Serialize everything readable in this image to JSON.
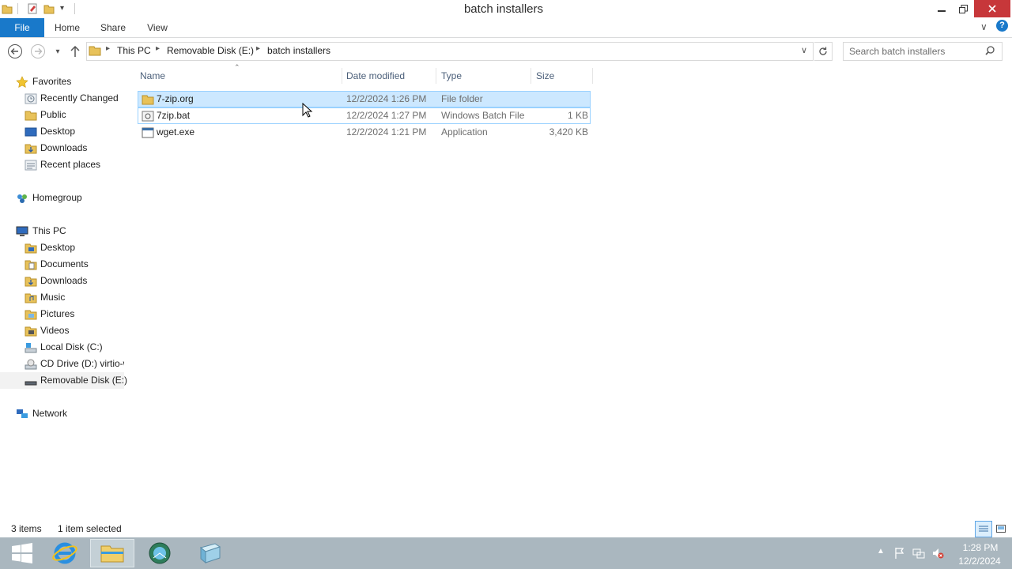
{
  "window": {
    "title": "batch installers"
  },
  "ribbon": {
    "tabs": [
      "File",
      "Home",
      "Share",
      "View"
    ]
  },
  "address": {
    "crumbs": [
      "This PC",
      "Removable Disk (E:)",
      "batch installers"
    ],
    "search_placeholder": "Search batch installers"
  },
  "nav": {
    "favorites": "Favorites",
    "favorites_items": [
      "Recently Changed",
      "Public",
      "Desktop",
      "Downloads",
      "Recent places"
    ],
    "homegroup": "Homegroup",
    "this_pc": "This PC",
    "pc_items": [
      "Desktop",
      "Documents",
      "Downloads",
      "Music",
      "Pictures",
      "Videos",
      "Local Disk (C:)",
      "CD Drive (D:) virtio-w",
      "Removable Disk (E:)"
    ],
    "network": "Network"
  },
  "columns": {
    "name": "Name",
    "date": "Date modified",
    "type": "Type",
    "size": "Size"
  },
  "files": [
    {
      "name": "7-zip.org",
      "date": "12/2/2024 1:26 PM",
      "type": "File folder",
      "size": "",
      "icon": "folder-icon"
    },
    {
      "name": "7zip.bat",
      "date": "12/2/2024 1:27 PM",
      "type": "Windows Batch File",
      "size": "1 KB",
      "icon": "batch-file-icon"
    },
    {
      "name": "wget.exe",
      "date": "12/2/2024 1:21 PM",
      "type": "Application",
      "size": "3,420 KB",
      "icon": "application-icon"
    }
  ],
  "status": {
    "count": "3 items",
    "selected": "1 item selected"
  },
  "taskbar": {
    "time": "1:28 PM",
    "date": "12/2/2024"
  },
  "colors": {
    "accent": "#1979ca",
    "selection": "#cce8ff",
    "taskbar": "#aab7bf",
    "close": "#c7373a"
  }
}
